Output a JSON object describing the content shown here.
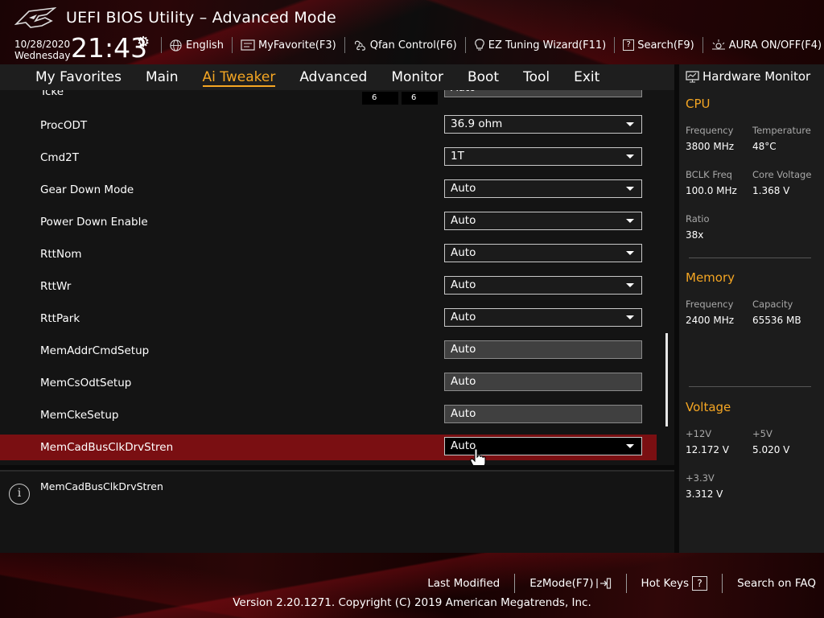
{
  "header": {
    "title": "UEFI BIOS Utility – Advanced Mode",
    "date": "10/28/2020",
    "day": "Wednesday",
    "time": "21:43",
    "toolbar": [
      {
        "label": "English",
        "icon": "globe-icon"
      },
      {
        "label": "MyFavorite(F3)",
        "icon": "favorite-icon"
      },
      {
        "label": "Qfan Control(F6)",
        "icon": "fan-icon"
      },
      {
        "label": "EZ Tuning Wizard(F11)",
        "icon": "bulb-icon"
      },
      {
        "label": "Search(F9)",
        "icon": "question-icon"
      },
      {
        "label": "AURA ON/OFF(F4)",
        "icon": "aura-icon"
      }
    ]
  },
  "nav": {
    "tabs": [
      "My Favorites",
      "Main",
      "Ai Tweaker",
      "Advanced",
      "Monitor",
      "Boot",
      "Tool",
      "Exit"
    ],
    "active": "Ai Tweaker"
  },
  "settings": {
    "partial_row": {
      "label": "Tcke",
      "mini1": "6",
      "mini2": "6",
      "value": "Auto"
    },
    "rows": [
      {
        "label": "ProcODT",
        "value": "36.9 ohm",
        "type": "dropdown"
      },
      {
        "label": "Cmd2T",
        "value": "1T",
        "type": "dropdown"
      },
      {
        "label": "Gear Down Mode",
        "value": "Auto",
        "type": "dropdown"
      },
      {
        "label": "Power Down Enable",
        "value": "Auto",
        "type": "dropdown"
      },
      {
        "label": "RttNom",
        "value": "Auto",
        "type": "dropdown"
      },
      {
        "label": "RttWr",
        "value": "Auto",
        "type": "dropdown"
      },
      {
        "label": "RttPark",
        "value": "Auto",
        "type": "dropdown"
      },
      {
        "label": "MemAddrCmdSetup",
        "value": "Auto",
        "type": "text"
      },
      {
        "label": "MemCsOdtSetup",
        "value": "Auto",
        "type": "text"
      },
      {
        "label": "MemCkeSetup",
        "value": "Auto",
        "type": "text"
      },
      {
        "label": "MemCadBusClkDrvStren",
        "value": "Auto",
        "type": "dropdown",
        "selected": true
      }
    ]
  },
  "info": {
    "text": "MemCadBusClkDrvStren"
  },
  "hardware_monitor": {
    "title": "Hardware Monitor",
    "cpu": {
      "heading": "CPU",
      "frequency_label": "Frequency",
      "frequency": "3800 MHz",
      "temperature_label": "Temperature",
      "temperature": "48°C",
      "bclk_label": "BCLK Freq",
      "bclk": "100.0 MHz",
      "core_voltage_label": "Core Voltage",
      "core_voltage": "1.368 V",
      "ratio_label": "Ratio",
      "ratio": "38x"
    },
    "memory": {
      "heading": "Memory",
      "frequency_label": "Frequency",
      "frequency": "2400 MHz",
      "capacity_label": "Capacity",
      "capacity": "65536 MB"
    },
    "voltage": {
      "heading": "Voltage",
      "v12_label": "+12V",
      "v12": "12.172 V",
      "v5_label": "+5V",
      "v5": "5.020 V",
      "v33_label": "+3.3V",
      "v33": "3.312 V"
    }
  },
  "footer": {
    "links": [
      "Last Modified",
      "EzMode(F7)",
      "Hot Keys",
      "Search on FAQ"
    ],
    "hotkeys_glyph": "?",
    "version": "Version 2.20.1271. Copyright (C) 2019 American Megatrends, Inc."
  },
  "colors": {
    "accent": "#f5a623",
    "selected_row": "#7a0f12",
    "panel": "#141414"
  }
}
